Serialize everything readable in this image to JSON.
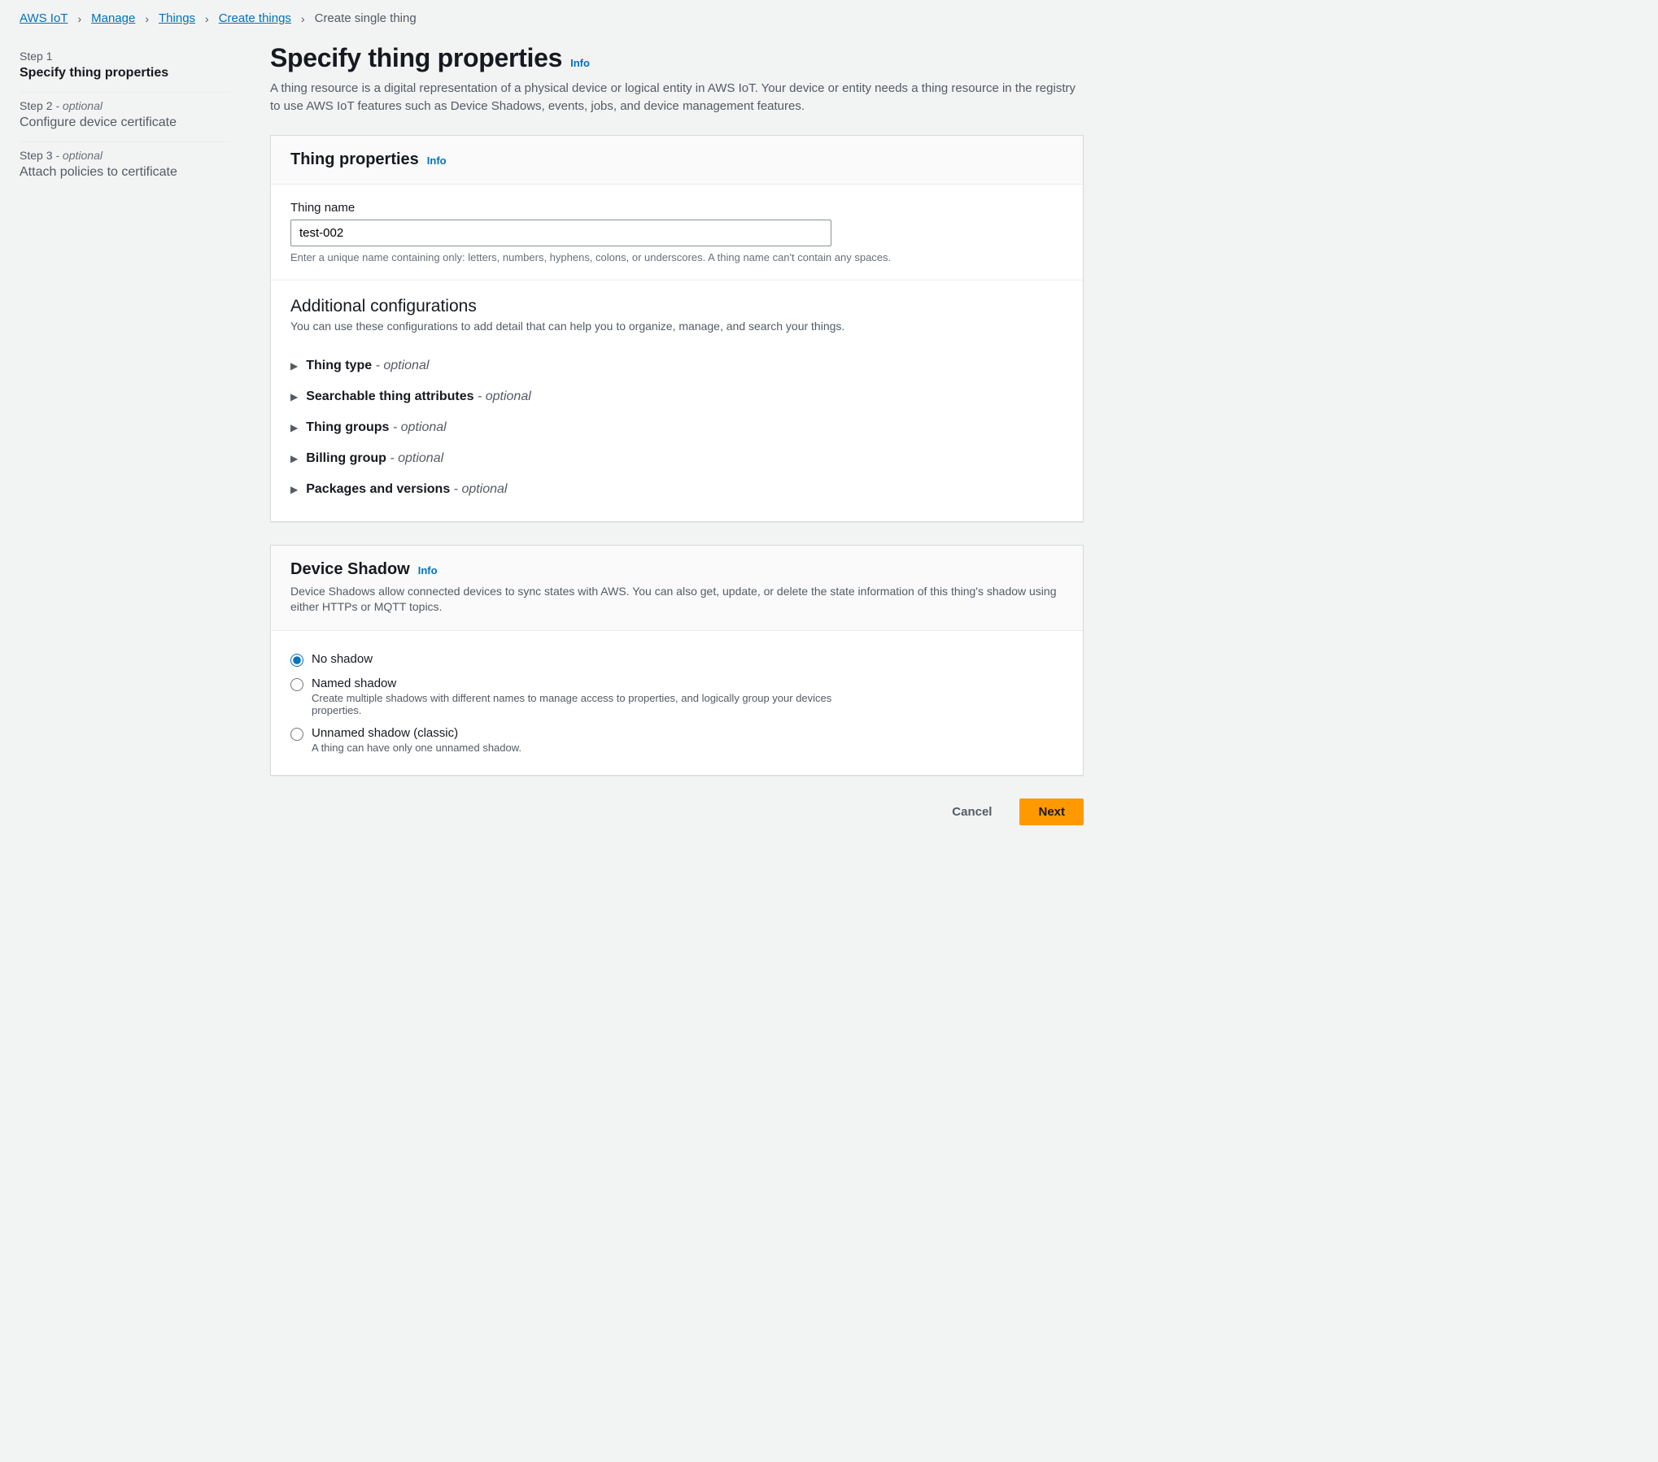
{
  "breadcrumb": {
    "items": [
      "AWS IoT",
      "Manage",
      "Things",
      "Create things"
    ],
    "current": "Create single thing"
  },
  "sidebar": {
    "steps": [
      {
        "label": "Step 1",
        "optional": "",
        "name": "Specify thing properties"
      },
      {
        "label": "Step 2",
        "optional": " - optional",
        "name": "Configure device certificate"
      },
      {
        "label": "Step 3",
        "optional": " - optional",
        "name": "Attach policies to certificate"
      }
    ]
  },
  "header": {
    "title": "Specify thing properties",
    "info": "Info",
    "description": "A thing resource is a digital representation of a physical device or logical entity in AWS IoT. Your device or entity needs a thing resource in the registry to use AWS IoT features such as Device Shadows, events, jobs, and device management features."
  },
  "thingProps": {
    "title": "Thing properties",
    "info": "Info",
    "nameLabel": "Thing name",
    "nameValue": "test-002",
    "nameHelp": "Enter a unique name containing only: letters, numbers, hyphens, colons, or underscores. A thing name can't contain any spaces."
  },
  "additional": {
    "title": "Additional configurations",
    "desc": "You can use these configurations to add detail that can help you to organize, manage, and search your things.",
    "expanders": [
      {
        "label": "Thing type",
        "opt": " - optional"
      },
      {
        "label": "Searchable thing attributes",
        "opt": " - optional"
      },
      {
        "label": "Thing groups",
        "opt": " - optional"
      },
      {
        "label": "Billing group",
        "opt": " - optional"
      },
      {
        "label": "Packages and versions",
        "opt": " - optional"
      }
    ]
  },
  "shadow": {
    "title": "Device Shadow",
    "info": "Info",
    "desc": "Device Shadows allow connected devices to sync states with AWS. You can also get, update, or delete the state information of this thing's shadow using either HTTPs or MQTT topics.",
    "options": [
      {
        "label": "No shadow",
        "desc": ""
      },
      {
        "label": "Named shadow",
        "desc": "Create multiple shadows with different names to manage access to properties, and logically group your devices properties."
      },
      {
        "label": "Unnamed shadow (classic)",
        "desc": "A thing can have only one unnamed shadow."
      }
    ]
  },
  "footer": {
    "cancel": "Cancel",
    "next": "Next"
  }
}
